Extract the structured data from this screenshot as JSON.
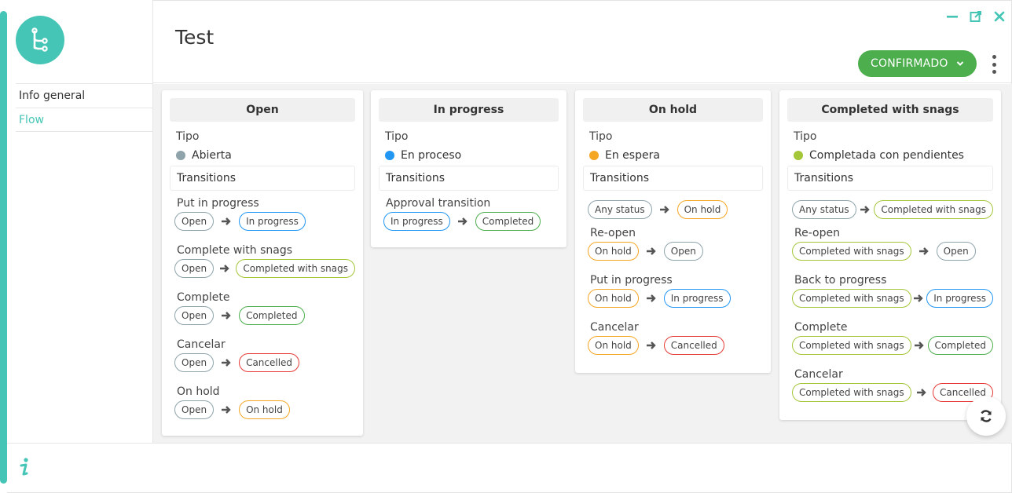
{
  "window": {
    "title": "Test"
  },
  "icons": {
    "logo": "flow-branch-icon",
    "minimize": "minimize-icon",
    "popout": "popout-icon",
    "close": "close-icon",
    "more": "kebab-menu-icon",
    "info": "info-icon",
    "refresh": "refresh-icon",
    "arrow": "arrow-right-icon",
    "chevron": "chevron-down-icon"
  },
  "colors": {
    "accent": "#45c5b5",
    "confirm": "#4cae4c",
    "abierta": "#8fa3ab",
    "en_proceso": "#2196f3",
    "en_espera": "#f5a623",
    "completada_pendientes": "#a4c639"
  },
  "sidebar": {
    "items": [
      {
        "label": "Info general",
        "active": false
      },
      {
        "label": "Flow",
        "active": true
      }
    ]
  },
  "header": {
    "status_label": "CONFIRMADO"
  },
  "columns": [
    {
      "name": "Open",
      "tipo_label": "Tipo",
      "tipo_value": "Abierta",
      "transitions_label": "Transitions",
      "transitions": [
        {
          "name": "Put in progress",
          "from": "Open",
          "to": "In progress"
        },
        {
          "name": "Complete with snags",
          "from": "Open",
          "to": "Completed with snags"
        },
        {
          "name": "Complete",
          "from": "Open",
          "to": "Completed"
        },
        {
          "name": "Cancelar",
          "from": "Open",
          "to": "Cancelled"
        },
        {
          "name": "On hold",
          "from": "Open",
          "to": "On hold"
        }
      ]
    },
    {
      "name": "In progress",
      "tipo_label": "Tipo",
      "tipo_value": "En proceso",
      "transitions_label": "Transitions",
      "transitions": [
        {
          "name": "Approval transition",
          "from": "In progress",
          "to": "Completed"
        }
      ]
    },
    {
      "name": "On hold",
      "tipo_label": "Tipo",
      "tipo_value": "En espera",
      "transitions_label": "Transitions",
      "transitions": [
        {
          "name": "",
          "from": "Any status",
          "to": "On hold"
        },
        {
          "name": "Re-open",
          "from": "On hold",
          "to": "Open"
        },
        {
          "name": "Put in progress",
          "from": "On hold",
          "to": "In progress"
        },
        {
          "name": "Cancelar",
          "from": "On hold",
          "to": "Cancelled"
        }
      ]
    },
    {
      "name": "Completed with snags",
      "tipo_label": "Tipo",
      "tipo_value": "Completada con pendientes",
      "transitions_label": "Transitions",
      "transitions": [
        {
          "name": "",
          "from": "Any status",
          "to": "Completed with snags"
        },
        {
          "name": "Re-open",
          "from": "Completed with snags",
          "to": "Open"
        },
        {
          "name": "Back to progress",
          "from": "Completed with snags",
          "to": "In progress"
        },
        {
          "name": "Complete",
          "from": "Completed with snags",
          "to": "Completed"
        },
        {
          "name": "Cancelar",
          "from": "Completed with snags",
          "to": "Cancelled"
        }
      ]
    }
  ]
}
